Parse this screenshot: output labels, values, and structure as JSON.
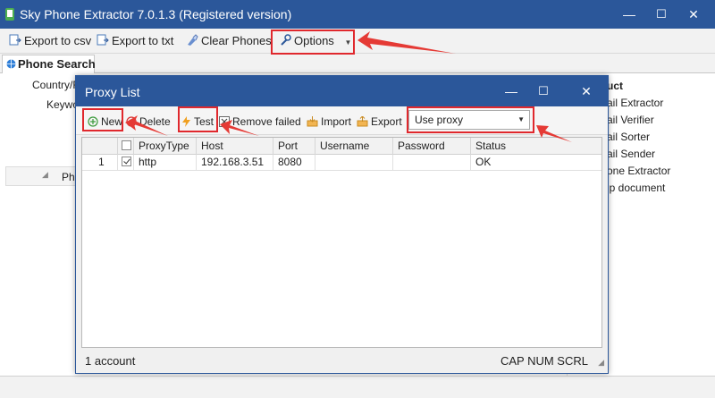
{
  "window": {
    "title": "Sky Phone Extractor 7.0.1.3 (Registered version)",
    "controls": {
      "minimize": "—",
      "maximize": "☐",
      "close": "✕"
    }
  },
  "toolbar": {
    "export_csv": "Export to csv",
    "export_txt": "Export to txt",
    "clear_phones": "Clear Phones",
    "options": "Options"
  },
  "tabs": {
    "phone_search": "Phone Search"
  },
  "background": {
    "country_label": "Country/R",
    "keyword_label": "Keywo",
    "phone_col": "Phon",
    "right_panel": [
      "uct",
      "ail Extractor",
      "ail Verifier",
      "ail Sorter",
      "ail Sender",
      "one Extractor",
      "lp document"
    ]
  },
  "dialog": {
    "title": "Proxy List",
    "toolbar": {
      "new": "New",
      "delete": "Delete",
      "test": "Test",
      "remove_failed": "Remove failed",
      "import": "Import",
      "export": "Export",
      "proxy_mode": "Use proxy"
    },
    "grid": {
      "columns": [
        "",
        "",
        "ProxyType",
        "Host",
        "Port",
        "Username",
        "Password",
        "Status"
      ],
      "rows": [
        {
          "num": "1",
          "checked": true,
          "type": "http",
          "host": "192.168.3.51",
          "port": "8080",
          "username": "",
          "password": "",
          "status": "OK"
        }
      ]
    },
    "status": {
      "count": "1 account",
      "keys": "CAP NUM SCRL"
    }
  },
  "colors": {
    "titlebar": "#2b579a",
    "highlight": "#e0282d"
  },
  "icons": [
    "export-csv-icon",
    "export-txt-icon",
    "clear-phones-icon",
    "wrench-icon",
    "globe-icon",
    "plus-circle-icon",
    "delete-circle-icon",
    "lightning-icon",
    "remove-failed-icon",
    "import-icon",
    "export-icon"
  ]
}
